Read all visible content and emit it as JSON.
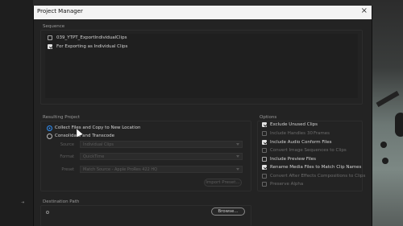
{
  "dialog": {
    "title": "Project Manager",
    "close_icon": "×"
  },
  "sequence": {
    "heading": "Sequence",
    "items": [
      {
        "label": "039_YTPT_ExportIndividualClips",
        "checked": false
      },
      {
        "label": "For Exporting as Individual Clips",
        "checked": true
      }
    ]
  },
  "resulting_project": {
    "heading": "Resulting Project",
    "options": [
      {
        "label": "Collect Files and Copy to New Location",
        "selected": true
      },
      {
        "label": "Consolidate and Transcode",
        "selected": false
      }
    ],
    "fields": [
      {
        "label": "Source",
        "value": "Individual Clips"
      },
      {
        "label": "Format",
        "value": "QuickTime"
      },
      {
        "label": "Preset",
        "value": "Match Source - Apple ProRes 422 HQ"
      }
    ],
    "import_preset_label": "Import Preset..."
  },
  "options": {
    "heading": "Options",
    "items": [
      {
        "label": "Exclude Unused Clips",
        "checked": true,
        "enabled": true
      },
      {
        "label": "Include Handles",
        "checked": false,
        "enabled": false
      },
      {
        "label": "Include Audio Conform Files",
        "checked": true,
        "enabled": true
      },
      {
        "label": "Convert Image Sequences to Clips",
        "checked": false,
        "enabled": false
      },
      {
        "label": "Include Preview Files",
        "checked": false,
        "enabled": true
      },
      {
        "label": "Rename Media Files to Match Clip Names",
        "checked": true,
        "enabled": true
      },
      {
        "label": "Convert After Effects Compositions to Clips",
        "checked": false,
        "enabled": false
      },
      {
        "label": "Preserve Alpha",
        "checked": false,
        "enabled": false
      }
    ],
    "handles_value": "30",
    "handles_unit": "Frames"
  },
  "destination": {
    "heading": "Destination Path",
    "browse_label": "Browse..."
  },
  "background": {
    "left_mark": "⇥"
  },
  "colors": {
    "accent": "#3a91f5",
    "titlebar": "#f3f3f3",
    "dialog_bg": "#232323"
  }
}
